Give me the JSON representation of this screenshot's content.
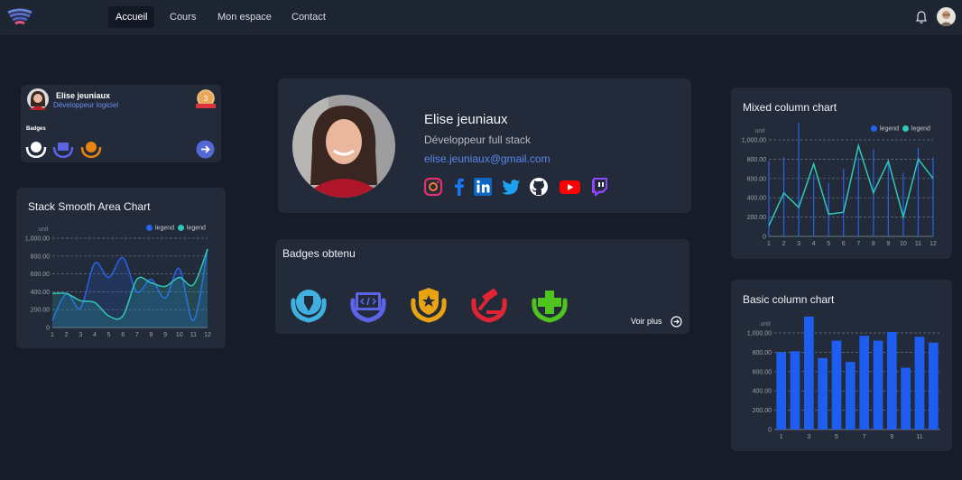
{
  "nav": {
    "items": [
      {
        "label": "Accueil",
        "active": true
      },
      {
        "label": "Cours",
        "active": false
      },
      {
        "label": "Mon espace",
        "active": false
      },
      {
        "label": "Contact",
        "active": false
      }
    ]
  },
  "mini_profile": {
    "name": "Elise jeuniaux",
    "role": "Développeur logiciel",
    "badges_label": "Badges",
    "rank_badge": "3"
  },
  "profile": {
    "name": "Elise jeuniaux",
    "role": "Développeur full stack",
    "email": "elise.jeuniaux@gmail.com",
    "socials": [
      "instagram-icon",
      "facebook-icon",
      "linkedin-icon",
      "twitter-icon",
      "github-icon",
      "youtube-icon",
      "twitch-icon"
    ]
  },
  "badges": {
    "title": "Badges obtenu",
    "see_more": "Voir plus",
    "items": [
      {
        "icon": "pen-nib-icon",
        "color": "#3fb0e0"
      },
      {
        "icon": "code-icon",
        "color": "#5b63e6"
      },
      {
        "icon": "star-shield-icon",
        "color": "#e8a313"
      },
      {
        "icon": "gavel-icon",
        "color": "#e02433"
      },
      {
        "icon": "plus-icon",
        "color": "#4fc41f"
      }
    ]
  },
  "colors": {
    "accent_blue": "#2563eb",
    "accent_teal": "#2fc8b8"
  },
  "chart_data": [
    {
      "type": "area",
      "title": "Stack Smooth Area Chart",
      "unit_label": "unit",
      "x": [
        1,
        2,
        3,
        4,
        5,
        6,
        7,
        8,
        9,
        10,
        11,
        12
      ],
      "ylim": [
        0,
        1000
      ],
      "yticks": [
        "1,000.00",
        "800.00",
        "600.00",
        "400.00",
        "200.00",
        "0"
      ],
      "series": [
        {
          "name": "legend",
          "color": "#2563eb",
          "values": [
            80,
            380,
            220,
            720,
            560,
            780,
            400,
            540,
            330,
            660,
            80,
            880
          ]
        },
        {
          "name": "legend",
          "color": "#2fc8b8",
          "values": [
            380,
            380,
            300,
            280,
            130,
            130,
            540,
            500,
            460,
            560,
            480,
            880
          ]
        }
      ]
    },
    {
      "type": "line",
      "title": "Mixed column chart",
      "unit_label": "unit",
      "x": [
        1,
        2,
        3,
        4,
        5,
        6,
        7,
        8,
        9,
        10,
        11,
        12
      ],
      "ylim": [
        0,
        1000
      ],
      "yticks": [
        "1,000.00",
        "800.00",
        "600.00",
        "400.00",
        "200.00",
        "0"
      ],
      "series": [
        {
          "name": "legend",
          "color": "#2563eb",
          "values": [
            780,
            820,
            1180,
            640,
            560,
            700,
            820,
            900,
            780,
            660,
            920,
            820
          ]
        },
        {
          "name": "legend",
          "color": "#2fc8b8",
          "values": [
            110,
            450,
            300,
            750,
            230,
            250,
            940,
            450,
            780,
            200,
            800,
            600
          ]
        }
      ]
    },
    {
      "type": "bar",
      "title": "Basic column chart",
      "unit_label": "unit",
      "x": [
        1,
        2,
        3,
        4,
        5,
        6,
        7,
        8,
        9,
        10,
        11,
        12
      ],
      "xticks": [
        "1",
        "3",
        "5",
        "7",
        "9",
        "11"
      ],
      "ylim": [
        0,
        1000
      ],
      "yticks": [
        "1,000.00",
        "800.00",
        "600.00",
        "400.00",
        "200.00",
        "0"
      ],
      "series": [
        {
          "color": "#1d5ef0",
          "values": [
            800,
            810,
            1170,
            740,
            920,
            700,
            970,
            920,
            1010,
            640,
            960,
            900
          ]
        }
      ]
    }
  ]
}
